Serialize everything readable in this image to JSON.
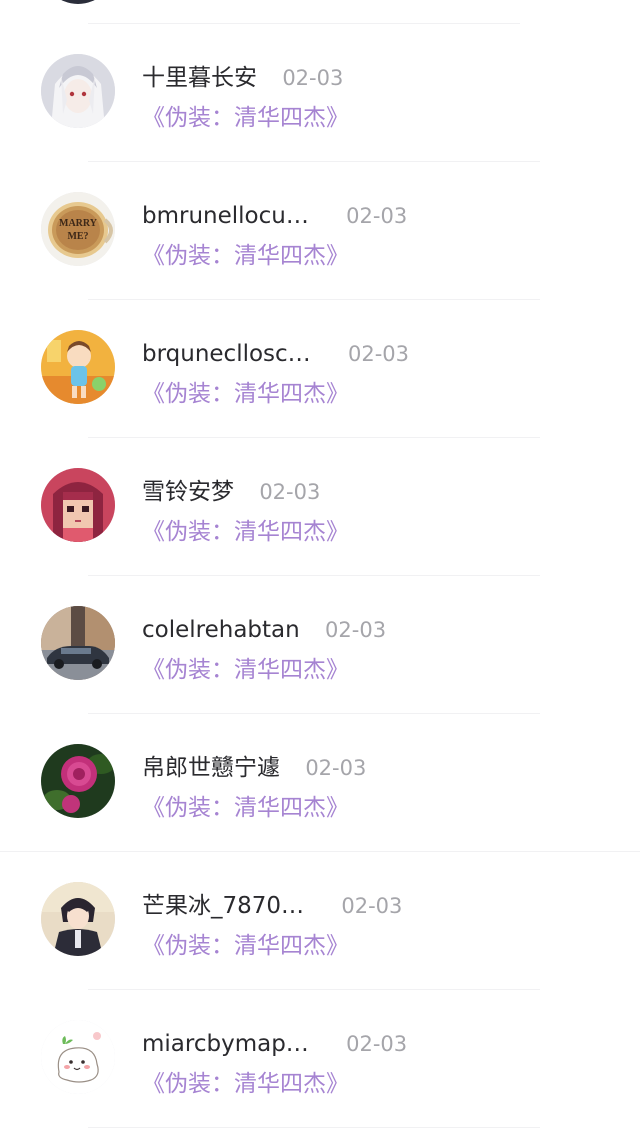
{
  "comments": [
    {
      "username": "十里暮长安",
      "date": "02-03",
      "book": "《伪装：清华四杰》",
      "avatar": "anime-white-hair-avatar"
    },
    {
      "username": "bmrunellocu…",
      "date": "02-03",
      "book": "《伪装：清华四杰》",
      "avatar": "marry-me-cup-avatar"
    },
    {
      "username": "brqunecllosc…",
      "date": "02-03",
      "book": "《伪装：清华四杰》",
      "avatar": "cartoon-girl-avatar"
    },
    {
      "username": "雪铃安梦",
      "date": "02-03",
      "book": "《伪装：清华四杰》",
      "avatar": "pixel-girl-avatar"
    },
    {
      "username": "colelrehabtan",
      "date": "02-03",
      "book": "《伪装：清华四杰》",
      "avatar": "car-street-avatar"
    },
    {
      "username": "帛郎世戆宁遽",
      "date": "02-03",
      "book": "《伪装：清华四杰》",
      "avatar": "pink-rose-avatar"
    },
    {
      "username": "芒果冰_7870…",
      "date": "02-03",
      "book": "《伪装：清华四杰》",
      "avatar": "anime-boy-avatar"
    },
    {
      "username": "miarcbymap…",
      "date": "02-03",
      "book": "《伪装：清华四杰》",
      "avatar": "cute-ghost-avatar"
    }
  ]
}
